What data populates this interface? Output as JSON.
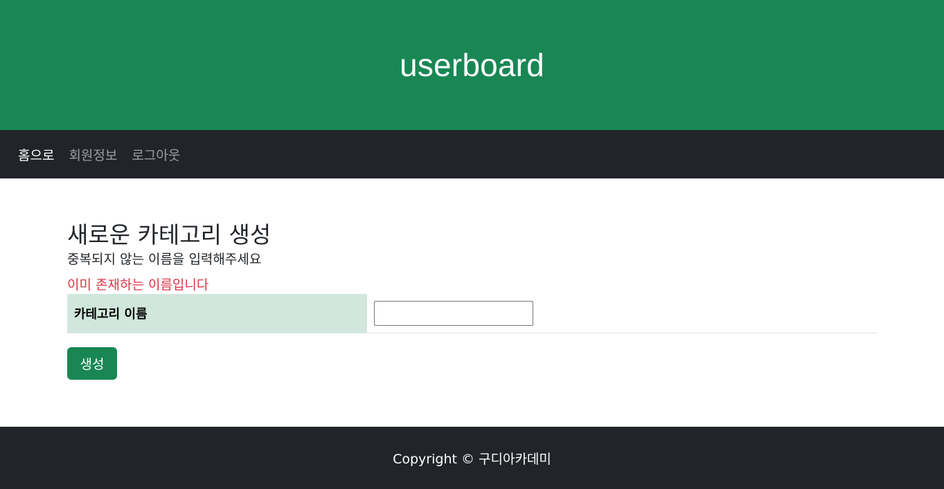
{
  "header": {
    "title": "userboard"
  },
  "nav": {
    "items": [
      {
        "label": "홈으로",
        "active": true
      },
      {
        "label": "회원정보",
        "active": false
      },
      {
        "label": "로그아웃",
        "active": false
      }
    ]
  },
  "main": {
    "heading": "새로운 카테고리 생성",
    "subtitle": "중복되지 않는 이름을 입력해주세요",
    "error_message": "이미 존재하는 이름입니다",
    "form": {
      "category_name_label": "카테고리 이름",
      "category_name_value": "",
      "submit_label": "생성"
    }
  },
  "footer": {
    "copyright": "Copyright © 구디아카데미"
  },
  "colors": {
    "brand_green": "#198754",
    "dark": "#212529",
    "label_bg": "#d1e7dd",
    "error": "#dc3545"
  }
}
